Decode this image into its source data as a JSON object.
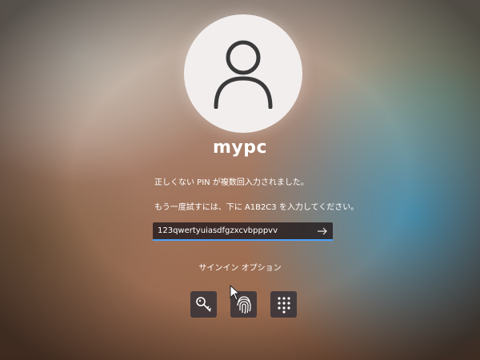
{
  "user": {
    "name": "mypc"
  },
  "messages": {
    "line1": "正しくない PIN が複数回入力されました。",
    "line2": "もう一度試すには、下に A1B2C3 を入力してください。"
  },
  "pin_input": {
    "value": "123qwertyuiasdfgzxcvbpppvv",
    "submit_icon": "arrow-right-icon"
  },
  "signin_options": {
    "label": "サインイン オプション",
    "options": [
      {
        "icon": "key-icon"
      },
      {
        "icon": "fingerprint-icon"
      },
      {
        "icon": "pin-keypad-icon"
      }
    ]
  },
  "colors": {
    "accent": "#4aa3ff",
    "text": "#ffffff",
    "avatar_bg": "#f2eeee",
    "avatar_glyph": "#3a3a3a"
  }
}
